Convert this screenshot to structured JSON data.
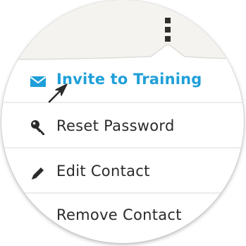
{
  "menu": {
    "items": [
      {
        "label": "Invite to Training",
        "icon": "envelope-icon",
        "highlighted": true,
        "color": "#1f9fd9"
      },
      {
        "label": "Reset Password",
        "icon": "key-icon"
      },
      {
        "label": "Edit Contact",
        "icon": "pencil-icon"
      },
      {
        "label": "Remove Contact",
        "icon": ""
      }
    ]
  },
  "trigger": {
    "icon": "kebab-menu-icon"
  },
  "colors": {
    "accent": "#1f9fd9",
    "text": "#2b2b2b",
    "header_band": "#f4f3ef",
    "divider": "#ececea"
  }
}
